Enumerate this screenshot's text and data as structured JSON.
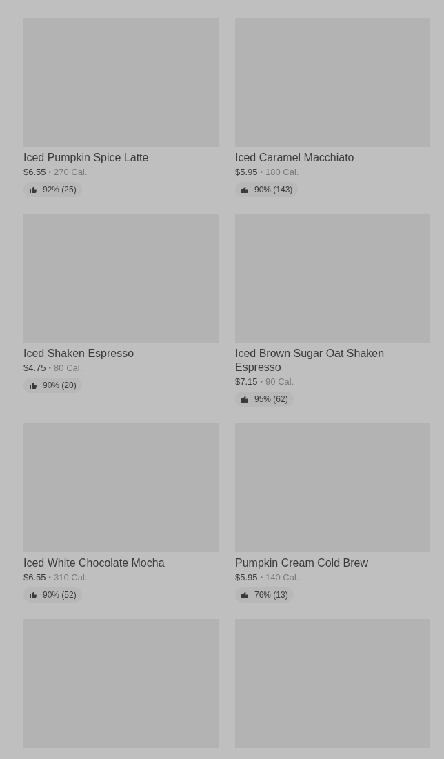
{
  "items": [
    {
      "kind": "full",
      "title": "Iced Pumpkin Spice Latte",
      "price": "$6.55",
      "separator": "•",
      "calories": "270 Cal.",
      "rating": "92% (25)"
    },
    {
      "kind": "full",
      "title": "Iced Caramel Macchiato",
      "price": "$5.95",
      "separator": "•",
      "calories": "180 Cal.",
      "rating": "90% (143)"
    },
    {
      "kind": "full",
      "title": "Iced Shaken Espresso",
      "price": "$4.75",
      "separator": "•",
      "calories": "80 Cal.",
      "rating": "90% (20)"
    },
    {
      "kind": "full",
      "title": "Iced Brown Sugar Oat Shaken Espresso",
      "price": "$7.15",
      "separator": "•",
      "calories": "90 Cal.",
      "rating": "95% (62)"
    },
    {
      "kind": "full",
      "title": "Iced White Chocolate Mocha",
      "price": "$6.55",
      "separator": "•",
      "calories": "310 Cal.",
      "rating": "90% (52)"
    },
    {
      "kind": "full",
      "title": "Pumpkin Cream Cold Brew",
      "price": "$5.95",
      "separator": "•",
      "calories": "140 Cal.",
      "rating": "76% (13)"
    },
    {
      "kind": "image_only"
    },
    {
      "kind": "image_only"
    }
  ]
}
